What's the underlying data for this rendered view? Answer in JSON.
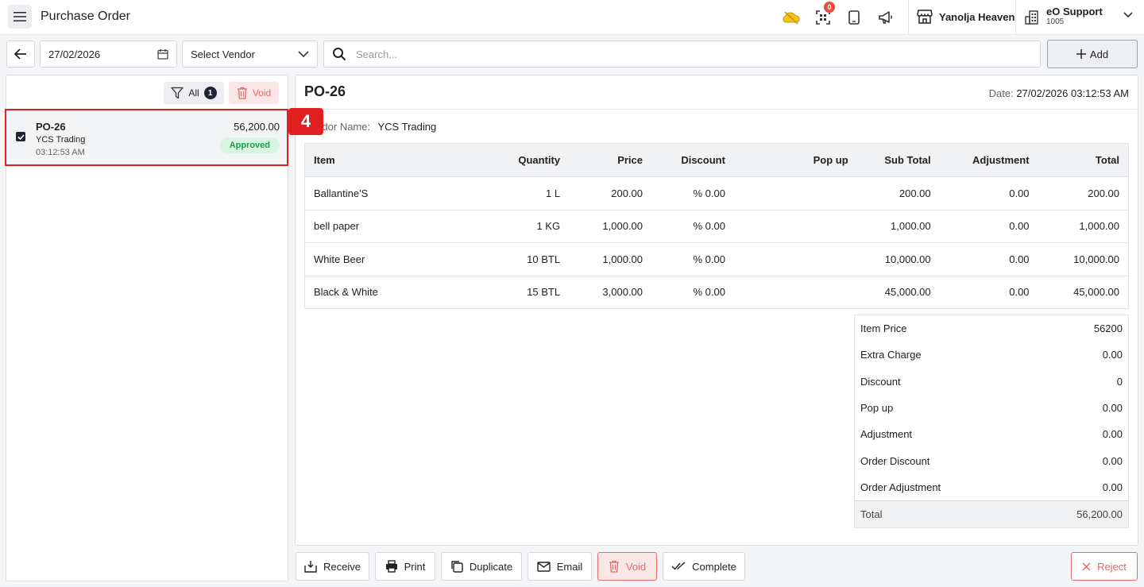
{
  "header": {
    "title": "Purchase Order",
    "qr_badge_count": "0",
    "property_name": "Yanolja Heaven",
    "user_name": "eO Support",
    "user_id": "1005"
  },
  "filters": {
    "date": "27/02/2026",
    "vendor_select": "Select Vendor",
    "search_placeholder": "Search...",
    "add_label": "Add"
  },
  "list_panel": {
    "filter_label": "All",
    "filter_count": "1",
    "void_label": "Void",
    "orders": [
      {
        "number": "PO-26",
        "vendor": "YCS Trading",
        "time": "03:12:53 AM",
        "amount": "56,200.00",
        "status": "Approved"
      }
    ],
    "step_marker": "4"
  },
  "detail": {
    "title": "PO-26",
    "date_label": "Date:",
    "date_value": "27/02/2026 03:12:53 AM",
    "vendor_label": "Vendor Name:",
    "vendor_value": "YCS Trading",
    "columns": [
      "Item",
      "Quantity",
      "Price",
      "Discount",
      "Pop up",
      "Sub Total",
      "Adjustment",
      "Total"
    ],
    "rows": [
      [
        "Ballantine'S",
        "1 L",
        "200.00",
        "% 0.00",
        "",
        "200.00",
        "0.00",
        "200.00"
      ],
      [
        "bell paper",
        "1 KG",
        "1,000.00",
        "% 0.00",
        "",
        "1,000.00",
        "0.00",
        "1,000.00"
      ],
      [
        "White Beer",
        "10 BTL",
        "1,000.00",
        "% 0.00",
        "",
        "10,000.00",
        "0.00",
        "10,000.00"
      ],
      [
        "Black & White",
        "15 BTL",
        "3,000.00",
        "% 0.00",
        "",
        "45,000.00",
        "0.00",
        "45,000.00"
      ]
    ],
    "summary": [
      {
        "label": "Item Price",
        "value": "56200"
      },
      {
        "label": "Extra Charge",
        "value": "0.00"
      },
      {
        "label": "Discount",
        "value": "0"
      },
      {
        "label": "Pop up",
        "value": "0.00"
      },
      {
        "label": "Adjustment",
        "value": "0.00"
      },
      {
        "label": "Order Discount",
        "value": "0.00"
      },
      {
        "label": "Order Adjustment",
        "value": "0.00"
      }
    ],
    "total_label": "Total",
    "total_value": "56,200.00"
  },
  "actions": {
    "receive": "Receive",
    "print": "Print",
    "duplicate": "Duplicate",
    "email": "Email",
    "void": "Void",
    "complete": "Complete",
    "reject": "Reject"
  }
}
